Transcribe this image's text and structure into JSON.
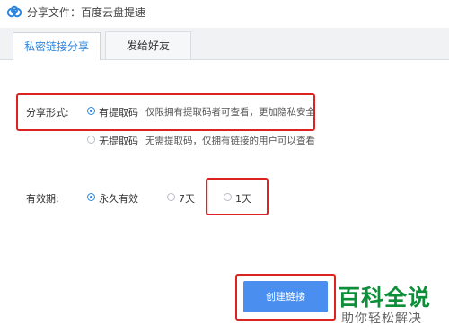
{
  "window": {
    "title": "分享文件：百度云盘提速",
    "icon": "baidu-cloud-icon"
  },
  "tabs": [
    {
      "label": "私密链接分享",
      "active": true
    },
    {
      "label": "发给好友",
      "active": false
    }
  ],
  "share_form": {
    "label": "分享形式:",
    "options": [
      {
        "label": "有提取码",
        "description": "仅限拥有提取码者可查看，更加隐私安全",
        "selected": true
      },
      {
        "label": "无提取码",
        "description": "无需提取码，仅拥有链接的用户可以查看",
        "selected": false
      }
    ]
  },
  "validity": {
    "label": "有效期:",
    "options": [
      {
        "label": "永久有效",
        "selected": true
      },
      {
        "label": "7天",
        "selected": false
      },
      {
        "label": "1天",
        "selected": false
      }
    ]
  },
  "create_button": {
    "label": "创建链接"
  },
  "watermark": {
    "title": "百科全说",
    "subtitle": "助你轻松解决"
  },
  "colors": {
    "accent": "#2e86de",
    "button": "#4a8ff0",
    "highlight": "#dd2222",
    "watermark": "#0d8f3a"
  }
}
